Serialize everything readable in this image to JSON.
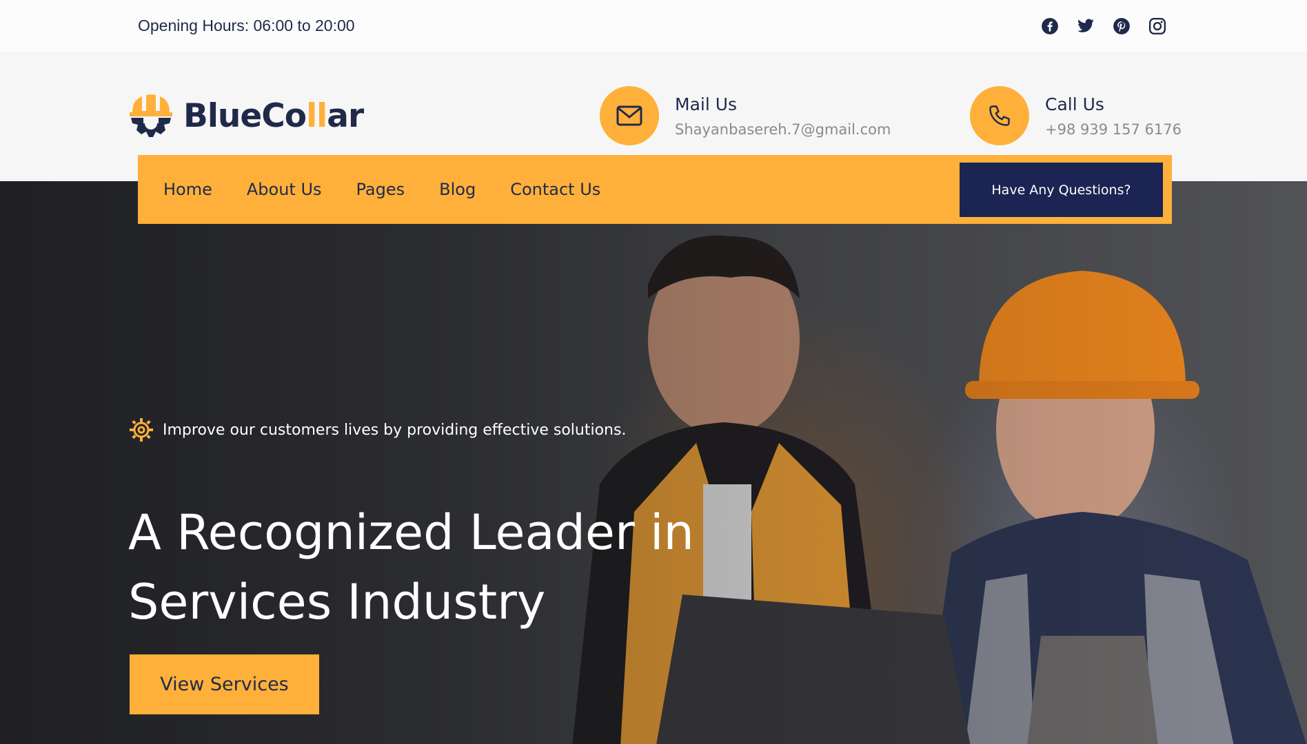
{
  "topbar": {
    "hours": "Opening Hours: 06:00 to 20:00",
    "socials": [
      "facebook-icon",
      "twitter-icon",
      "pinterest-icon",
      "instagram-icon"
    ]
  },
  "brand": {
    "name_part1": "BlueCo",
    "name_accent": "ll",
    "name_part2": "ar",
    "logo_icon": "hardhat-gear-icon"
  },
  "contacts": {
    "mail": {
      "label": "Mail Us",
      "value": "Shayanbasereh.7@gmail.com",
      "icon": "mail-icon"
    },
    "call": {
      "label": "Call Us",
      "value": "+98 939 157 6176",
      "icon": "phone-icon"
    }
  },
  "nav": {
    "items": [
      "Home",
      "About Us",
      "Pages",
      "Blog",
      "Contact Us"
    ],
    "cta": "Have Any Questions?"
  },
  "hero": {
    "tagline": "Improve our customers lives by providing effective solutions.",
    "headline_line1": "A Recognized Leader in",
    "headline_line2": "Services Industry",
    "button": "View Services"
  },
  "colors": {
    "accent": "#ffb03a",
    "navy": "#1f2a4a",
    "dark_button": "#1b2452"
  }
}
